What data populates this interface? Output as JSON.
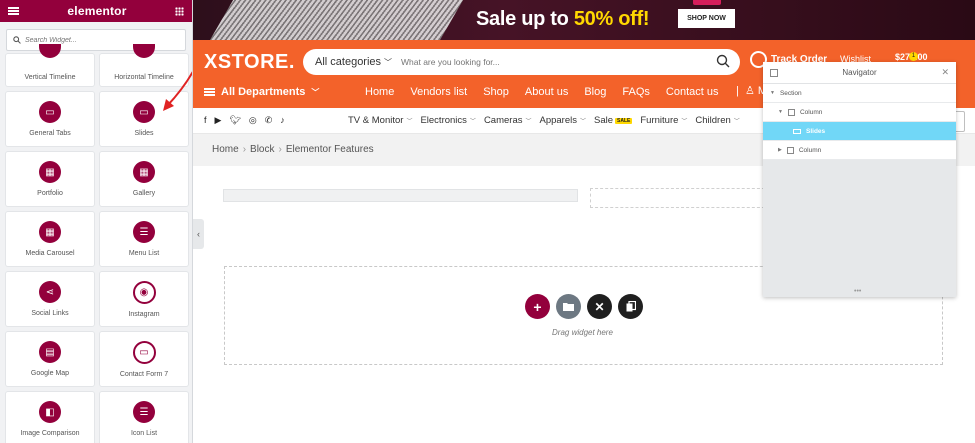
{
  "panel": {
    "title": "elementor",
    "search_placeholder": "Search Widget...",
    "widgets": [
      {
        "label": "Vertical Timeline",
        "icon": "vertical-timeline-icon"
      },
      {
        "label": "Horizontal Timeline",
        "icon": "horizontal-timeline-icon"
      },
      {
        "label": "General Tabs",
        "icon": "tabs-icon"
      },
      {
        "label": "Slides",
        "icon": "slides-icon"
      },
      {
        "label": "Portfolio",
        "icon": "portfolio-icon"
      },
      {
        "label": "Gallery",
        "icon": "gallery-icon"
      },
      {
        "label": "Media Carousel",
        "icon": "media-carousel-icon"
      },
      {
        "label": "Menu List",
        "icon": "menu-list-icon"
      },
      {
        "label": "Social Links",
        "icon": "share-icon"
      },
      {
        "label": "Instagram",
        "icon": "instagram-icon"
      },
      {
        "label": "Google Map",
        "icon": "map-icon"
      },
      {
        "label": "Contact Form 7",
        "icon": "form-icon"
      },
      {
        "label": "Image Comparison",
        "icon": "image-comparison-icon"
      },
      {
        "label": "Icon List",
        "icon": "icon-list-icon"
      }
    ],
    "accent": "#93003c"
  },
  "banner": {
    "text_pre": "Sale up to ",
    "text_highlight": "50% off!",
    "cta": "SHOP NOW"
  },
  "header": {
    "logo": "XSTORE.",
    "category_select": "All categories",
    "search_placeholder": "What are you looking for...",
    "track_order": "Track Order",
    "wishlist": "Wishlist",
    "cart_total": "$275.00",
    "cart_count": "1",
    "departments": "All Departments",
    "nav": [
      "Home",
      "Vendors list",
      "Shop",
      "About us",
      "Blog",
      "FAQs",
      "Contact us"
    ],
    "user_initial": "M",
    "accent": "#f3622a"
  },
  "subnav": {
    "categories": [
      {
        "label": "TV & Monitor",
        "chevron": true
      },
      {
        "label": "Electronics",
        "chevron": true
      },
      {
        "label": "Cameras",
        "chevron": true
      },
      {
        "label": "Apparels",
        "chevron": true
      },
      {
        "label": "Sale",
        "chevron": false,
        "tag": "SALE"
      },
      {
        "label": "Furniture",
        "chevron": true
      },
      {
        "label": "Children",
        "chevron": true
      }
    ]
  },
  "breadcrumb": [
    "Home",
    "Block",
    "Elementor Features"
  ],
  "canvas": {
    "drop_text": "Drag widget here"
  },
  "navigator": {
    "title": "Navigator",
    "tree": [
      {
        "label": "Section",
        "level": 0,
        "type": "section"
      },
      {
        "label": "Column",
        "level": 1,
        "type": "column",
        "expanded": true
      },
      {
        "label": "Slides",
        "level": 2,
        "type": "widget",
        "selected": true
      },
      {
        "label": "Column",
        "level": 1,
        "type": "column",
        "expanded": false
      }
    ]
  }
}
